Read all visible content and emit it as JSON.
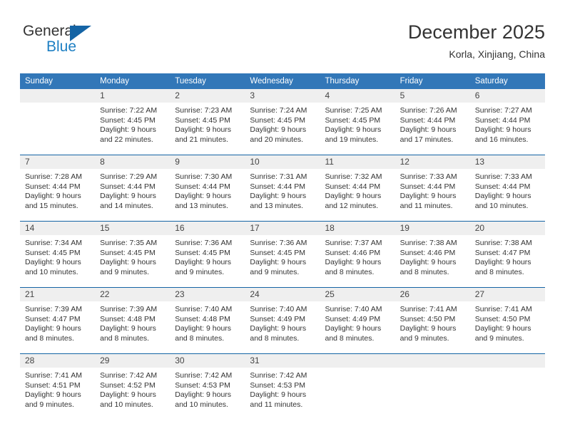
{
  "brand": {
    "name_part1": "General",
    "name_part2": "Blue",
    "icon": "triangle-logo"
  },
  "header": {
    "title": "December 2025",
    "location": "Korla, Xinjiang, China"
  },
  "weekdays": [
    "Sunday",
    "Monday",
    "Tuesday",
    "Wednesday",
    "Thursday",
    "Friday",
    "Saturday"
  ],
  "colors": {
    "header_blue": "#3277b8",
    "row_divider_blue": "#1464a5",
    "daynum_band": "#efefef",
    "brand_blue": "#1d7fc3"
  },
  "weeks": [
    [
      {
        "day": "",
        "lines": []
      },
      {
        "day": "1",
        "lines": [
          "Sunrise: 7:22 AM",
          "Sunset: 4:45 PM",
          "Daylight: 9 hours",
          "and 22 minutes."
        ]
      },
      {
        "day": "2",
        "lines": [
          "Sunrise: 7:23 AM",
          "Sunset: 4:45 PM",
          "Daylight: 9 hours",
          "and 21 minutes."
        ]
      },
      {
        "day": "3",
        "lines": [
          "Sunrise: 7:24 AM",
          "Sunset: 4:45 PM",
          "Daylight: 9 hours",
          "and 20 minutes."
        ]
      },
      {
        "day": "4",
        "lines": [
          "Sunrise: 7:25 AM",
          "Sunset: 4:45 PM",
          "Daylight: 9 hours",
          "and 19 minutes."
        ]
      },
      {
        "day": "5",
        "lines": [
          "Sunrise: 7:26 AM",
          "Sunset: 4:44 PM",
          "Daylight: 9 hours",
          "and 17 minutes."
        ]
      },
      {
        "day": "6",
        "lines": [
          "Sunrise: 7:27 AM",
          "Sunset: 4:44 PM",
          "Daylight: 9 hours",
          "and 16 minutes."
        ]
      }
    ],
    [
      {
        "day": "7",
        "lines": [
          "Sunrise: 7:28 AM",
          "Sunset: 4:44 PM",
          "Daylight: 9 hours",
          "and 15 minutes."
        ]
      },
      {
        "day": "8",
        "lines": [
          "Sunrise: 7:29 AM",
          "Sunset: 4:44 PM",
          "Daylight: 9 hours",
          "and 14 minutes."
        ]
      },
      {
        "day": "9",
        "lines": [
          "Sunrise: 7:30 AM",
          "Sunset: 4:44 PM",
          "Daylight: 9 hours",
          "and 13 minutes."
        ]
      },
      {
        "day": "10",
        "lines": [
          "Sunrise: 7:31 AM",
          "Sunset: 4:44 PM",
          "Daylight: 9 hours",
          "and 13 minutes."
        ]
      },
      {
        "day": "11",
        "lines": [
          "Sunrise: 7:32 AM",
          "Sunset: 4:44 PM",
          "Daylight: 9 hours",
          "and 12 minutes."
        ]
      },
      {
        "day": "12",
        "lines": [
          "Sunrise: 7:33 AM",
          "Sunset: 4:44 PM",
          "Daylight: 9 hours",
          "and 11 minutes."
        ]
      },
      {
        "day": "13",
        "lines": [
          "Sunrise: 7:33 AM",
          "Sunset: 4:44 PM",
          "Daylight: 9 hours",
          "and 10 minutes."
        ]
      }
    ],
    [
      {
        "day": "14",
        "lines": [
          "Sunrise: 7:34 AM",
          "Sunset: 4:45 PM",
          "Daylight: 9 hours",
          "and 10 minutes."
        ]
      },
      {
        "day": "15",
        "lines": [
          "Sunrise: 7:35 AM",
          "Sunset: 4:45 PM",
          "Daylight: 9 hours",
          "and 9 minutes."
        ]
      },
      {
        "day": "16",
        "lines": [
          "Sunrise: 7:36 AM",
          "Sunset: 4:45 PM",
          "Daylight: 9 hours",
          "and 9 minutes."
        ]
      },
      {
        "day": "17",
        "lines": [
          "Sunrise: 7:36 AM",
          "Sunset: 4:45 PM",
          "Daylight: 9 hours",
          "and 9 minutes."
        ]
      },
      {
        "day": "18",
        "lines": [
          "Sunrise: 7:37 AM",
          "Sunset: 4:46 PM",
          "Daylight: 9 hours",
          "and 8 minutes."
        ]
      },
      {
        "day": "19",
        "lines": [
          "Sunrise: 7:38 AM",
          "Sunset: 4:46 PM",
          "Daylight: 9 hours",
          "and 8 minutes."
        ]
      },
      {
        "day": "20",
        "lines": [
          "Sunrise: 7:38 AM",
          "Sunset: 4:47 PM",
          "Daylight: 9 hours",
          "and 8 minutes."
        ]
      }
    ],
    [
      {
        "day": "21",
        "lines": [
          "Sunrise: 7:39 AM",
          "Sunset: 4:47 PM",
          "Daylight: 9 hours",
          "and 8 minutes."
        ]
      },
      {
        "day": "22",
        "lines": [
          "Sunrise: 7:39 AM",
          "Sunset: 4:48 PM",
          "Daylight: 9 hours",
          "and 8 minutes."
        ]
      },
      {
        "day": "23",
        "lines": [
          "Sunrise: 7:40 AM",
          "Sunset: 4:48 PM",
          "Daylight: 9 hours",
          "and 8 minutes."
        ]
      },
      {
        "day": "24",
        "lines": [
          "Sunrise: 7:40 AM",
          "Sunset: 4:49 PM",
          "Daylight: 9 hours",
          "and 8 minutes."
        ]
      },
      {
        "day": "25",
        "lines": [
          "Sunrise: 7:40 AM",
          "Sunset: 4:49 PM",
          "Daylight: 9 hours",
          "and 8 minutes."
        ]
      },
      {
        "day": "26",
        "lines": [
          "Sunrise: 7:41 AM",
          "Sunset: 4:50 PM",
          "Daylight: 9 hours",
          "and 9 minutes."
        ]
      },
      {
        "day": "27",
        "lines": [
          "Sunrise: 7:41 AM",
          "Sunset: 4:50 PM",
          "Daylight: 9 hours",
          "and 9 minutes."
        ]
      }
    ],
    [
      {
        "day": "28",
        "lines": [
          "Sunrise: 7:41 AM",
          "Sunset: 4:51 PM",
          "Daylight: 9 hours",
          "and 9 minutes."
        ]
      },
      {
        "day": "29",
        "lines": [
          "Sunrise: 7:42 AM",
          "Sunset: 4:52 PM",
          "Daylight: 9 hours",
          "and 10 minutes."
        ]
      },
      {
        "day": "30",
        "lines": [
          "Sunrise: 7:42 AM",
          "Sunset: 4:53 PM",
          "Daylight: 9 hours",
          "and 10 minutes."
        ]
      },
      {
        "day": "31",
        "lines": [
          "Sunrise: 7:42 AM",
          "Sunset: 4:53 PM",
          "Daylight: 9 hours",
          "and 11 minutes."
        ]
      },
      {
        "day": "",
        "lines": []
      },
      {
        "day": "",
        "lines": []
      },
      {
        "day": "",
        "lines": []
      }
    ]
  ]
}
